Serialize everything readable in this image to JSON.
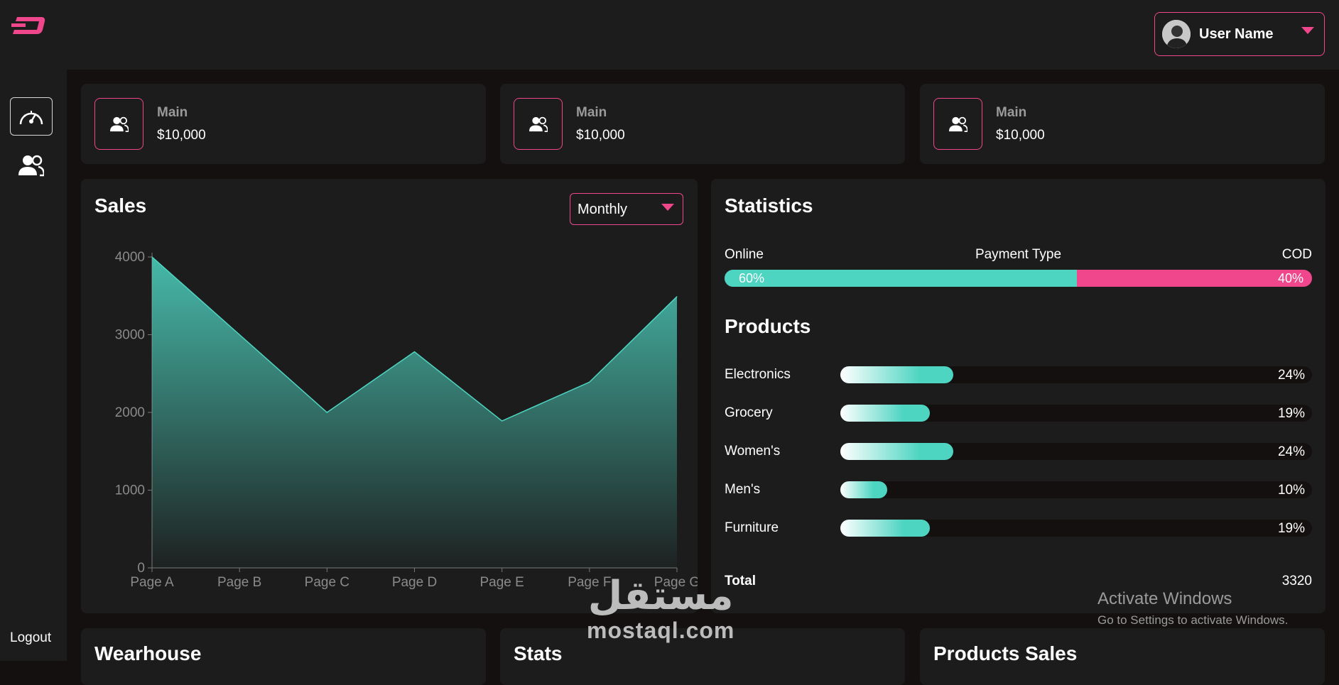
{
  "sidebar": {
    "logout_label": "Logout",
    "items": [
      {
        "icon": "speedometer-icon",
        "active": true
      },
      {
        "icon": "users-icon",
        "active": false
      }
    ]
  },
  "header": {
    "user_name": "User Name"
  },
  "stat_cards": [
    {
      "label": "Main",
      "value": "$10,000"
    },
    {
      "label": "Main",
      "value": "$10,000"
    },
    {
      "label": "Main",
      "value": "$10,000"
    }
  ],
  "sales": {
    "title": "Sales",
    "period": "Monthly"
  },
  "chart_data": {
    "type": "area",
    "categories": [
      "Page A",
      "Page B",
      "Page C",
      "Page D",
      "Page E",
      "Page F",
      "Page G"
    ],
    "values": [
      4000,
      3000,
      2000,
      2780,
      1890,
      2390,
      3490
    ],
    "yticks": [
      0,
      1000,
      2000,
      3000,
      4000
    ],
    "ylim": [
      0,
      4000
    ],
    "color": "#4ed5c2"
  },
  "statistics": {
    "title": "Statistics",
    "payment": {
      "left_label": "Online",
      "center_label": "Payment Type",
      "right_label": "COD",
      "online_pct": "60%",
      "cod_pct": "40%",
      "online_fraction": 0.6
    },
    "products_title": "Products",
    "products": [
      {
        "name": "Electronics",
        "pct": "24%",
        "fraction": 0.24
      },
      {
        "name": "Grocery",
        "pct": "19%",
        "fraction": 0.19
      },
      {
        "name": "Women's",
        "pct": "24%",
        "fraction": 0.24
      },
      {
        "name": "Men's",
        "pct": "10%",
        "fraction": 0.1
      },
      {
        "name": "Furniture",
        "pct": "19%",
        "fraction": 0.19
      }
    ],
    "total_label": "Total",
    "total_value": "3320"
  },
  "bottom_cards": [
    {
      "title": "Wearhouse"
    },
    {
      "title": "Stats"
    },
    {
      "title": "Products Sales"
    }
  ],
  "overlay": {
    "activate_title": "Activate Windows",
    "activate_sub": "Go to Settings to activate Windows.",
    "watermark_ar": "مستقل",
    "watermark_en": "mostaql.com"
  },
  "colors": {
    "accent": "#f0478c",
    "teal": "#4ed5c2",
    "card_bg": "#1c1c1c",
    "page_bg": "#141010"
  }
}
